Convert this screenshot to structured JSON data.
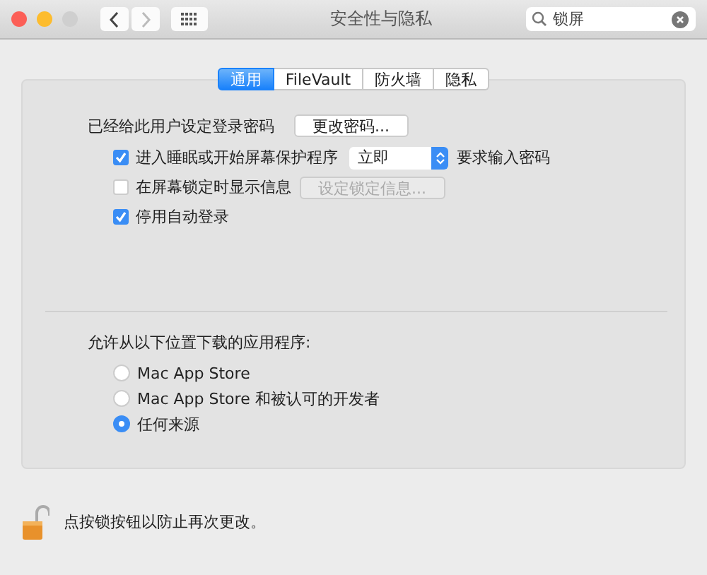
{
  "window": {
    "title": "安全性与隐私"
  },
  "search": {
    "value": "锁屏"
  },
  "tabs": [
    {
      "label": "通用",
      "selected": true
    },
    {
      "label": "FileVault",
      "selected": false
    },
    {
      "label": "防火墙",
      "selected": false
    },
    {
      "label": "隐私",
      "selected": false
    }
  ],
  "password": {
    "label": "已经给此用户设定登录密码",
    "button": "更改密码..."
  },
  "options": [
    {
      "kind": "popup",
      "label": "进入睡眠或开始屏幕保护程序",
      "checked": true,
      "popup": "立即",
      "suffix": "要求输入密码"
    },
    {
      "kind": "button",
      "label": "在屏幕锁定时显示信息",
      "checked": false,
      "button": "设定锁定信息...",
      "disabled": true
    },
    {
      "kind": "plain",
      "label": "停用自动登录",
      "checked": true
    }
  ],
  "downloads": {
    "heading": "允许从以下位置下载的应用程序:",
    "choices": [
      {
        "label": "Mac App Store",
        "selected": false
      },
      {
        "label": "Mac App Store 和被认可的开发者",
        "selected": false
      },
      {
        "label": "任何来源",
        "selected": true
      }
    ]
  },
  "footer": {
    "text": "点按锁按钮以防止再次更改。"
  }
}
